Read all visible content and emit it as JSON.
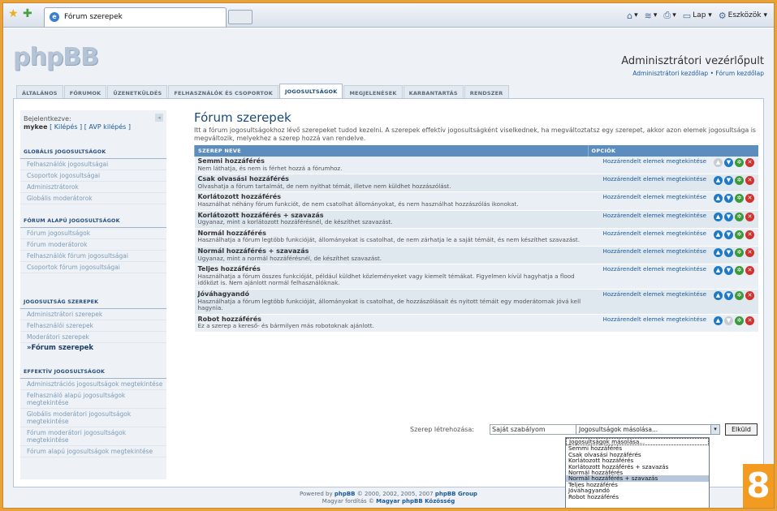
{
  "browser": {
    "tab_title": "Fórum szerepek",
    "commands": [
      {
        "icon": "home-icon",
        "label": "▾"
      },
      {
        "icon": "feeds-icon",
        "label": "▾"
      },
      {
        "icon": "print-icon",
        "label": "▾"
      },
      {
        "icon": "page-icon",
        "label": "Lap ▾"
      },
      {
        "icon": "tools-icon",
        "label": "Eszközök ▾"
      }
    ]
  },
  "header": {
    "logo": "phpBB",
    "admin_title": "Adminisztrátori vezérlőpult",
    "link_admin": "Adminisztrátori kezdőlap",
    "link_sep": " • ",
    "link_forum": "Fórum kezdőlap"
  },
  "navtabs": [
    "ÁLTALÁNOS",
    "FÓRUMOK",
    "ÜZENETKÜLDÉS",
    "FELHASZNÁLÓK ÉS CSOPORTOK",
    "JOGOSULTSÁGOK",
    "MEGJELENÉSEK",
    "KARBANTARTÁS",
    "RENDSZER"
  ],
  "sidebar": {
    "logged_label": "Bejelentkezve:",
    "username": "mykee",
    "logout": "[ Kilépés ]",
    "avp_logout": "[ AVP kilépés ]",
    "sections": [
      {
        "title": "GLOBÁLIS JOGOSULTSÁGOK",
        "items": [
          "Felhasználók jogosultságai",
          "Csoportok jogosultságai",
          "Adminisztrátorok",
          "Globális moderátorok"
        ]
      },
      {
        "title": "FÓRUM ALAPÚ JOGOSULTSÁGOK",
        "items": [
          "Fórum jogosultságok",
          "Fórum moderátorok",
          "Felhasználók fórum jogosultságai",
          "Csoportok fórum jogosultságai"
        ]
      },
      {
        "title": "JOGOSULTSÁG SZEREPEK",
        "items": [
          "Adminisztrátori szerepek",
          "Felhasználói szerepek",
          "Moderátori szerepek",
          "»Fórum szerepek"
        ]
      },
      {
        "title": "EFFEKTÍV JOGOSULTSÁGOK",
        "items": [
          "Adminisztrációs jogosultságok megtekintése",
          "Felhasználó alapú jogosultságok megtekintése",
          "Globális moderátori jogosultságok megtekintése",
          "Fórum moderátori jogosultságok megtekintése",
          "Fórum alapú jogosultságok megtekintése"
        ]
      }
    ]
  },
  "content": {
    "title": "Fórum szerepek",
    "description": "Itt a fórum jogosultságokhoz lévő szerepeket tudod kezelni. A szerepek effektív jogosultságként viselkednek, ha megváltoztatsz egy szerepet, akkor azon elemek jogosultsága is megváltozik, melyekhez a szerep hozzá van rendelve.",
    "col_role": "SZEREP NEVE",
    "col_options": "OPCIÓK",
    "assign_label": "Hozzárendelt elemek megtekintése",
    "roles": [
      {
        "name": "Semmi hozzáférés",
        "desc": "Nem láthatja, és nem is férhet hozzá a fórumhoz."
      },
      {
        "name": "Csak olvasási hozzáférés",
        "desc": "Olvashatja a fórum tartalmát, de nem nyithat témát, illetve nem küldhet hozzászólást."
      },
      {
        "name": "Korlátozott hozzáférés",
        "desc": "Használhat néhány fórum funkciót, de nem csatolhat állományokat, és nem használhat hozzászólás ikonokat."
      },
      {
        "name": "Korlátozott hozzáférés + szavazás",
        "desc": "Ugyanaz, mint a korlátozott hozzáférésnél, de készíthet szavazást."
      },
      {
        "name": "Normál hozzáférés",
        "desc": "Használhatja a fórum legtöbb funkcióját, állományokat is csatolhat, de nem zárhatja le a saját témáit, és nem készíthet szavazást."
      },
      {
        "name": "Normál hozzáférés + szavazás",
        "desc": "Ugyanaz, mint a normál hozzáférésnél, de készíthet szavazást."
      },
      {
        "name": "Teljes hozzáférés",
        "desc": "Használhatja a fórum összes funkcióját, például küldhet közleményeket vagy kiemelt témákat. Figyelmen kívül hagyhatja a flood időközt is. Nem ajánlott normál felhasználóknak."
      },
      {
        "name": "Jóváhagyandó",
        "desc": "Használhatja a fórum legtöbb funkcióját, állományokat is csatolhat, de hozzászólásait és nyitott témáit egy moderátornak jóvá kell hagynia."
      },
      {
        "name": "Robot hozzáférés",
        "desc": "Ez a szerep a kereső- és bármilyen más robotoknak ajánlott."
      }
    ],
    "create_label": "Szerep létrehozása:",
    "create_value": "Saját szabályom",
    "select_value": "Jogosultságok másolása...",
    "submit_label": "Elküld",
    "dropdown_options": [
      "Jogosultságok másolása...",
      "Semmi hozzáférés",
      "Csak olvasási hozzáférés",
      "Korlátozott hozzáférés",
      "Korlátozott hozzáférés + szavazás",
      "Normál hozzáférés",
      "Normál hozzáférés + szavazás",
      "Teljes hozzáférés",
      "Jóváhagyandó",
      "Robot hozzáférés"
    ]
  },
  "footer": {
    "line1_prefix": "Powered by ",
    "line1_brand": "phpBB",
    "line1_suffix": " © 2000, 2002, 2005, 2007 ",
    "line1_group": "phpBB Group",
    "line2_prefix": "Magyar fordítás © ",
    "line2_brand": "Magyar phpBB Közösség"
  },
  "badge": "8"
}
